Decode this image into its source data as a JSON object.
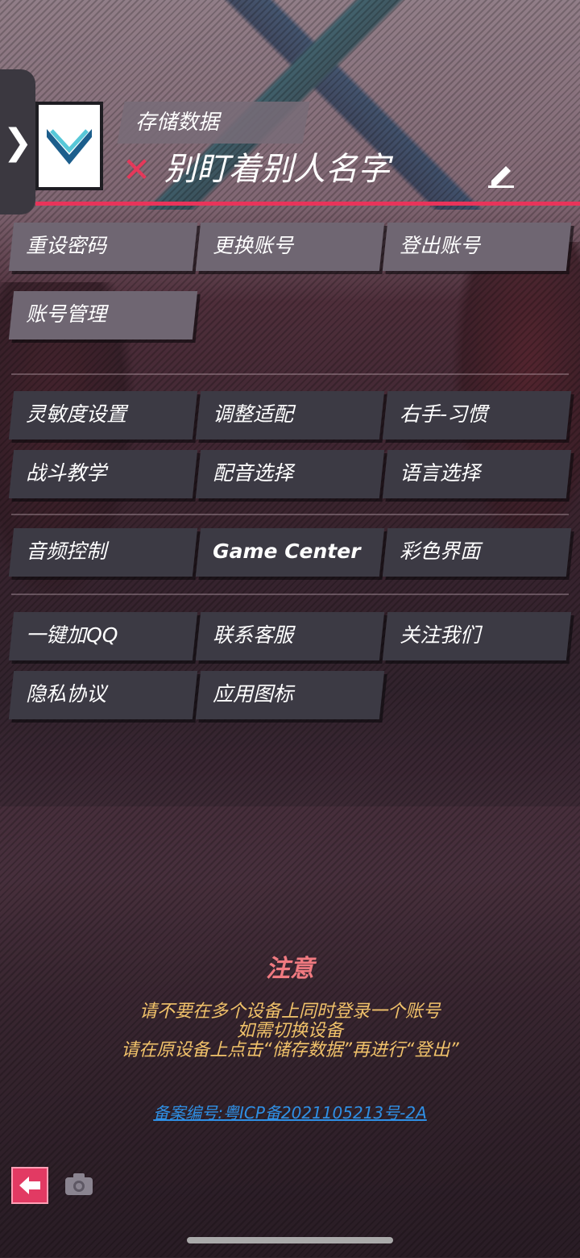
{
  "header": {
    "store_label": "存储数据",
    "username": "别盯着别人名字",
    "status_mark": "✕"
  },
  "account_buttons": [
    "重设密码",
    "更换账号",
    "登出账号",
    "账号管理"
  ],
  "settings_buttons": [
    "灵敏度设置",
    "调整适配",
    "右手-习惯",
    "战斗教学",
    "配音选择",
    "语言选择"
  ],
  "misc_buttons": [
    "音频控制",
    "Game Center",
    "彩色界面"
  ],
  "social_buttons": [
    "一键加QQ",
    "联系客服",
    "关注我们",
    "隐私协议",
    "应用图标"
  ],
  "notice": {
    "title": "注意",
    "lines": [
      "请不要在多个设备上同时登录一个账号",
      "如需切换设备",
      "请在原设备上点击“储存数据”再进行“登出”"
    ]
  },
  "icp": "备案编号:粤ICP备2021105213号-2A",
  "colors": {
    "accent": "#e8345a",
    "notice_title": "#f07a80",
    "notice_text": "#f1c26a",
    "link": "#2f8fe4"
  }
}
